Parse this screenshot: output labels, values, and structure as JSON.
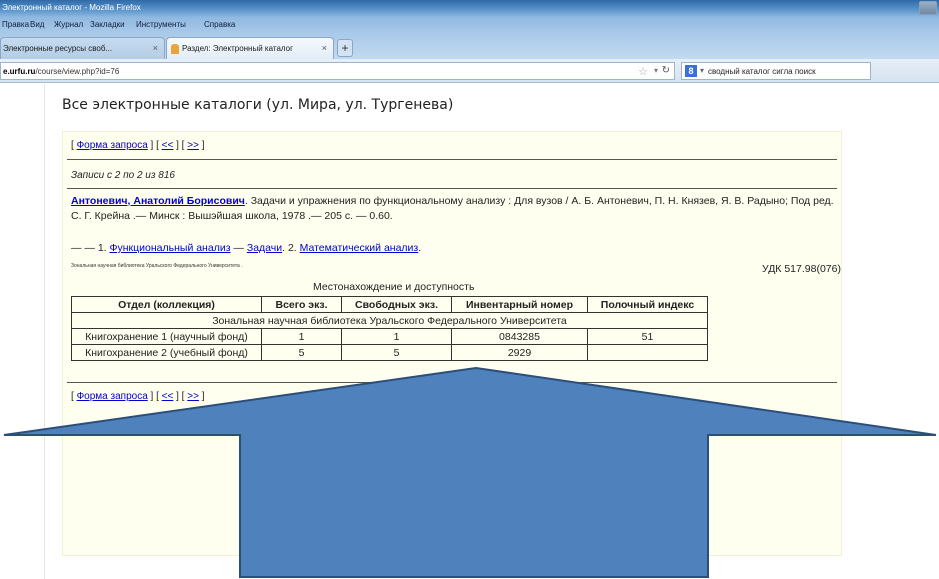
{
  "window": {
    "title": "Электронный каталог - Mozilla Firefox"
  },
  "menu": [
    "Правка",
    "Вид",
    "Журнал",
    "Закладки",
    "Инструменты",
    "Справка"
  ],
  "tabs": [
    {
      "label": "Электронные ресурсы своб...",
      "close": "×",
      "active": false
    },
    {
      "label": "Раздел: Электронный каталог",
      "close": "×",
      "active": true
    }
  ],
  "new_tab": "+",
  "address_bar": {
    "host": "e.urfu.ru",
    "path": "/course/view.php?id=76"
  },
  "search_box": {
    "engine": "8",
    "query": "сводный каталог сигла поиск"
  },
  "page": {
    "title": "Все электронные каталоги (ул. Мира, ул. Тургенева)",
    "nav": {
      "open": "[",
      "request_form": "Форма запроса",
      "sep1": "] [",
      "prev": "<<",
      "sep2": "] [",
      "next": ">>",
      "close": "]"
    },
    "records_info": "Записи с 2 по 2 из 816",
    "entry": {
      "author": "Антоневич, Анатолий Борисович",
      "text": ". Задачи и упражнения по функциональному анализу : Для вузов / А. Б. Антоневич, П. Н. Князев, Я. В. Радыно; Под ред. С. Г. Крейна .— Минск : Вышэйшая школа, 1978 .— 205 с. — 0.60."
    },
    "subjects": {
      "prefix": "— — 1. ",
      "s1": "Функциональный анализ",
      "dash": " — ",
      "s2": "Задачи",
      "mid": ". 2. ",
      "s3": "Математический анализ",
      "end": "."
    },
    "library_note": "Зональная научная библиотека Уральского Федерального Университета .",
    "udk": "УДК 517.98(076)",
    "availability_caption": "Местонахождение и доступность",
    "holdings": {
      "headers": [
        "Отдел (коллекция)",
        "Всего экз.",
        "Свободных экз.",
        "Инвентарный номер",
        "Полочный индекс"
      ],
      "library_row": "Зональная научная библиотека Уральского Федерального Университета",
      "rows": [
        [
          "Книгохранение 1 (научный фонд)",
          "1",
          "1",
          "0843285",
          "51"
        ],
        [
          "Книгохранение 2 (учебный фонд)",
          "5",
          "5",
          "2929",
          ""
        ]
      ]
    }
  },
  "colors": {
    "content_bg": "#fffff0",
    "link": "#0000cc",
    "arrow_fill": "#4f81bd",
    "arrow_stroke": "#2c4f7a"
  }
}
